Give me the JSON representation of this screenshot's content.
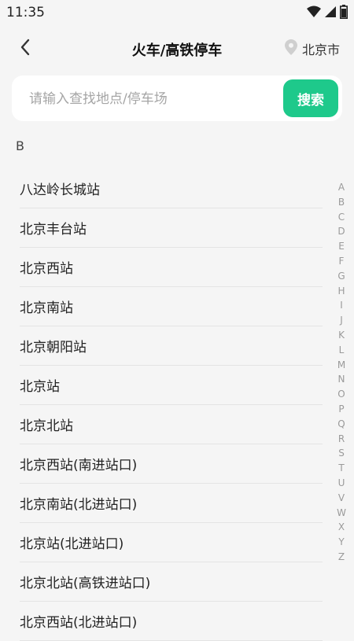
{
  "status_bar": {
    "time": "11:35",
    "icons": [
      "wifi-icon",
      "signal-icon",
      "battery-icon"
    ]
  },
  "header": {
    "back_icon": "chevron-left-icon",
    "title": "火车/高铁停车",
    "city_icon": "location-pin-icon",
    "city": "北京市"
  },
  "search": {
    "placeholder": "请输入查找地点/停车场",
    "value": "",
    "button_label": "搜索"
  },
  "section": {
    "letter": "B",
    "stations": [
      "八达岭长城站",
      "北京丰台站",
      "北京西站",
      "北京南站",
      "北京朝阳站",
      "北京站",
      "北京北站",
      "北京西站(南进站口)",
      "北京南站(北进站口)",
      "北京站(北进站口)",
      "北京北站(高铁进站口)",
      "北京西站(北进站口)"
    ]
  },
  "alphabet_index": [
    "A",
    "B",
    "C",
    "D",
    "E",
    "F",
    "G",
    "H",
    "I",
    "J",
    "K",
    "L",
    "M",
    "N",
    "O",
    "P",
    "Q",
    "R",
    "S",
    "T",
    "U",
    "V",
    "W",
    "X",
    "Y",
    "Z"
  ],
  "colors": {
    "accent": "#1ec98b",
    "background": "#f5f5f5",
    "card": "#ffffff"
  }
}
